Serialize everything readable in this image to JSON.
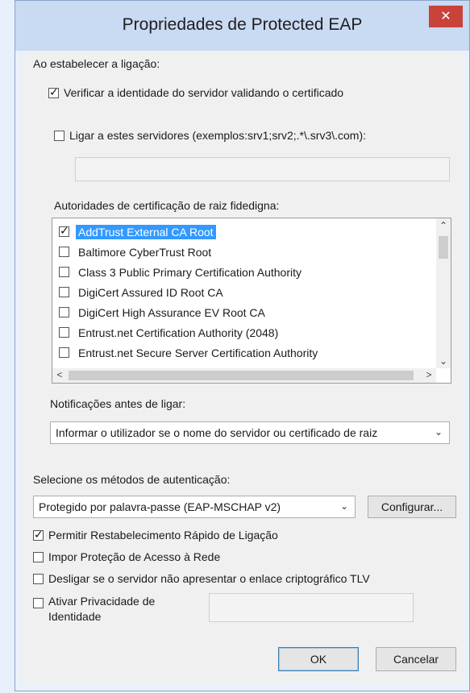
{
  "window": {
    "title": "Propriedades de Protected EAP",
    "close_glyph": "✕"
  },
  "connection": {
    "section_label": "Ao estabelecer a ligação:",
    "verify_identity": {
      "label": "Verificar a identidade do servidor validando o certificado",
      "checked": true
    },
    "connect_servers": {
      "label": "Ligar a estes servidores (exemplos:srv1;srv2;.*\\.srv3\\.com):",
      "checked": false
    },
    "servers_value": ""
  },
  "root_ca": {
    "label": "Autoridades de certificação de raiz fidedigna:",
    "items": [
      {
        "label": "AddTrust External CA Root",
        "checked": true,
        "selected": true
      },
      {
        "label": "Baltimore CyberTrust Root",
        "checked": false
      },
      {
        "label": "Class 3 Public Primary Certification Authority",
        "checked": false
      },
      {
        "label": "DigiCert Assured ID Root CA",
        "checked": false
      },
      {
        "label": "DigiCert High Assurance EV Root CA",
        "checked": false
      },
      {
        "label": "Entrust.net Certification Authority (2048)",
        "checked": false
      },
      {
        "label": "Entrust.net Secure Server Certification Authority",
        "checked": false
      }
    ]
  },
  "notifications": {
    "label": "Notificações antes de ligar:",
    "selected": "Informar o utilizador se o nome do servidor ou certificado de raiz"
  },
  "auth": {
    "label": "Selecione os métodos de autenticação:",
    "method": "Protegido por palavra-passe (EAP-MSCHAP v2)",
    "configure_label": "Configurar..."
  },
  "options": {
    "fast_reconnect": {
      "label": "Permitir Restabelecimento Rápido de Ligação",
      "checked": true
    },
    "nap": {
      "label": "Impor Proteção de Acesso à Rede",
      "checked": false
    },
    "tlv": {
      "label": "Desligar se o servidor não apresentar o enlace criptográfico TLV",
      "checked": false
    },
    "privacy_line1": "Ativar Privacidade de",
    "privacy_line2": "Identidade",
    "privacy_checked": false,
    "privacy_value": ""
  },
  "footer": {
    "ok_label": "OK",
    "cancel_label": "Cancelar"
  },
  "icons": {
    "scroll_up": "⌃",
    "scroll_down": "⌄",
    "scroll_left": "<",
    "scroll_right": ">",
    "dropdown": "⌄"
  }
}
